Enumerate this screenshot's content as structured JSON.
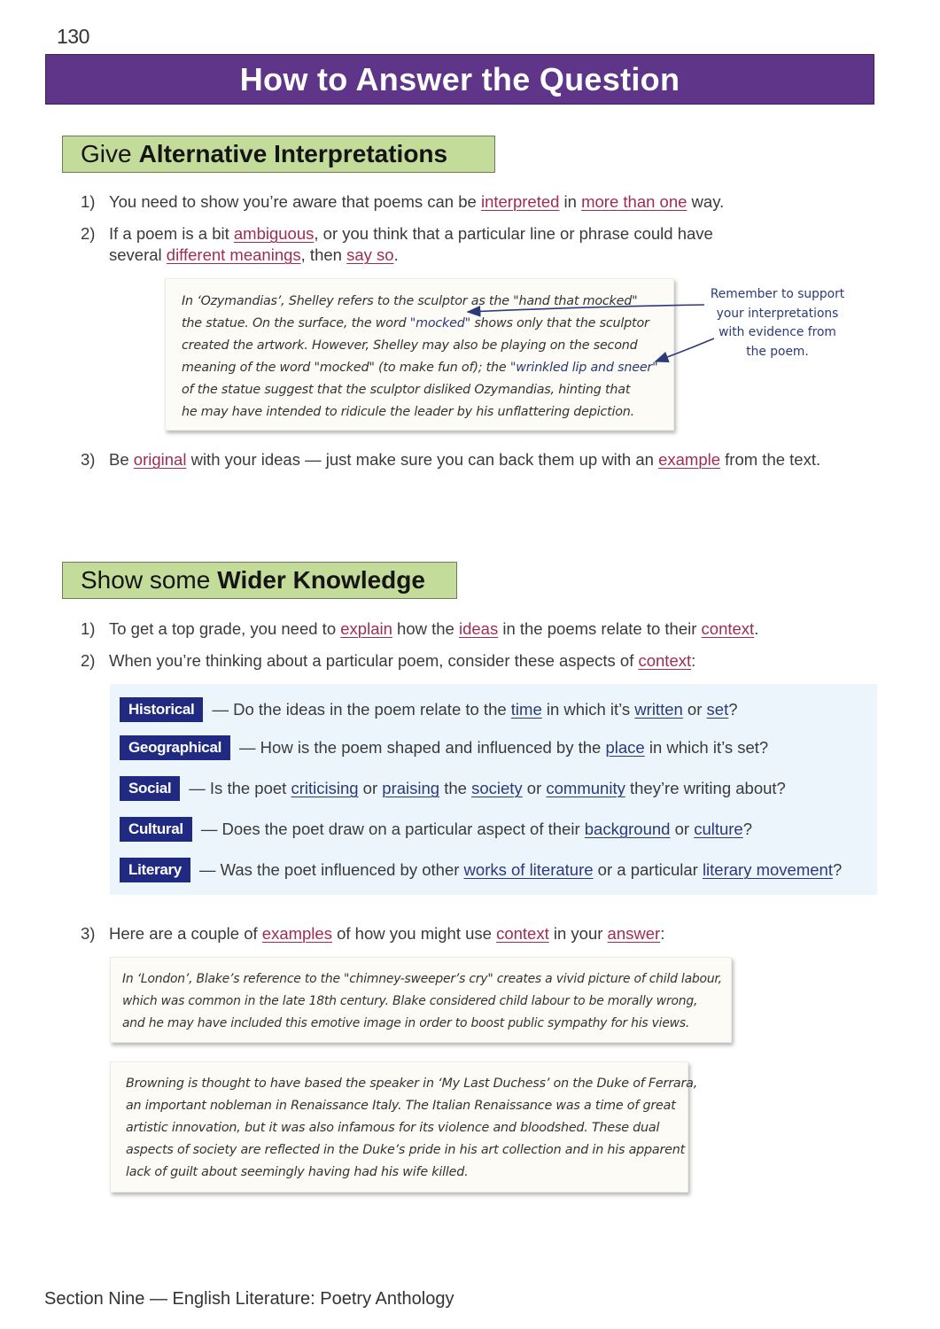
{
  "page_number": "130",
  "title": "How to Answer the Question",
  "section1": {
    "heading_plain": "Give",
    "heading_bold": "Alternative Interpretations",
    "items": [
      {
        "num": "1)",
        "parts": [
          {
            "t": "You need to show you’re aware that poems can be "
          },
          {
            "t": "interpreted",
            "kw": true
          },
          {
            "t": " in "
          },
          {
            "t": "more than one",
            "kw": true
          },
          {
            "t": " way."
          }
        ]
      },
      {
        "num": "2)",
        "line1": [
          {
            "t": "If a poem is a bit "
          },
          {
            "t": "ambiguous",
            "kw": true
          },
          {
            "t": ", or you think that a particular line or phrase could have"
          }
        ],
        "line2": [
          {
            "t": "several "
          },
          {
            "t": "different meanings",
            "kw": true
          },
          {
            "t": ", then "
          },
          {
            "t": "say so",
            "kw": true
          },
          {
            "t": "."
          }
        ]
      },
      {
        "num": "3)",
        "parts": [
          {
            "t": "Be "
          },
          {
            "t": "original",
            "kw": true
          },
          {
            "t": " with your ideas — just make sure you can back them up with an "
          },
          {
            "t": "example",
            "kw": true
          },
          {
            "t": " from the text."
          }
        ]
      }
    ],
    "example_box": {
      "lines": [
        [
          {
            "t": "In ‘Ozymandias’, Shelley refers to the sculptor as the \"hand that mocked\""
          }
        ],
        [
          {
            "t": "the statue.  On the surface, the word "
          },
          {
            "t": "\"mocked\"",
            "q": true
          },
          {
            "t": " shows only that the sculptor"
          }
        ],
        [
          {
            "t": "created the artwork.  However, Shelley may also be playing on the second"
          }
        ],
        [
          {
            "t": "meaning of the word \"mocked\" (to make fun of); the "
          },
          {
            "t": "\"wrinkled lip and sneer\"",
            "q": true
          }
        ],
        [
          {
            "t": "of the statue suggest that the sculptor disliked Ozymandias, hinting that"
          }
        ],
        [
          {
            "t": "he may have intended to ridicule the leader by his unflattering depiction."
          }
        ]
      ]
    },
    "annotation": [
      "Remember to support",
      "your interpretations",
      "with evidence from",
      "the poem."
    ]
  },
  "section2": {
    "heading_plain": "Show some",
    "heading_bold": "Wider Knowledge",
    "items": [
      {
        "num": "1)",
        "parts": [
          {
            "t": "To get a top grade, you need to "
          },
          {
            "t": "explain",
            "kw": true
          },
          {
            "t": " how the "
          },
          {
            "t": "ideas",
            "kw": true
          },
          {
            "t": " in the poems relate to their "
          },
          {
            "t": "context",
            "kw": true
          },
          {
            "t": "."
          }
        ]
      },
      {
        "num": "2)",
        "parts": [
          {
            "t": "When you’re thinking about a particular poem, consider these aspects of "
          },
          {
            "t": "context",
            "kw": true
          },
          {
            "t": ":"
          }
        ]
      },
      {
        "num": "3)",
        "parts": [
          {
            "t": "Here are a couple of "
          },
          {
            "t": "examples",
            "kw": true
          },
          {
            "t": " of how you might use "
          },
          {
            "t": "context",
            "kw": true
          },
          {
            "t": " in your "
          },
          {
            "t": "answer",
            "kw": true
          },
          {
            "t": ":"
          }
        ]
      }
    ],
    "context_aspects": [
      {
        "tag": "Historical",
        "parts": [
          {
            "t": "— Do the ideas in the poem relate to the "
          },
          {
            "t": "time",
            "kb": true
          },
          {
            "t": " in which it’s "
          },
          {
            "t": "written",
            "kb": true
          },
          {
            "t": " or "
          },
          {
            "t": "set",
            "kb": true
          },
          {
            "t": "?"
          }
        ]
      },
      {
        "tag": "Geographical",
        "parts": [
          {
            "t": "— How is the poem shaped and influenced by the "
          },
          {
            "t": "place",
            "kb": true
          },
          {
            "t": " in which it’s set?"
          }
        ]
      },
      {
        "tag": "Social",
        "parts": [
          {
            "t": "— Is the poet "
          },
          {
            "t": "criticising",
            "kb": true
          },
          {
            "t": " or "
          },
          {
            "t": "praising",
            "kb": true
          },
          {
            "t": " the "
          },
          {
            "t": "society",
            "kb": true
          },
          {
            "t": " or "
          },
          {
            "t": "community",
            "kb": true
          },
          {
            "t": " they’re writing about?"
          }
        ]
      },
      {
        "tag": "Cultural",
        "parts": [
          {
            "t": "— Does the poet draw on a particular aspect of their "
          },
          {
            "t": "background",
            "kb": true
          },
          {
            "t": " or "
          },
          {
            "t": "culture",
            "kb": true
          },
          {
            "t": "?"
          }
        ]
      },
      {
        "tag": "Literary",
        "parts": [
          {
            "t": "— Was the poet influenced by other "
          },
          {
            "t": "works of literature",
            "kb": true
          },
          {
            "t": " or a particular "
          },
          {
            "t": "literary movement",
            "kb": true
          },
          {
            "t": "?"
          }
        ]
      }
    ],
    "example_boxes": [
      {
        "lines": [
          "In ‘London’, Blake’s reference to the \"chimney-sweeper’s cry\" creates a vivid picture of child labour,",
          "which was common in the late 18th century.  Blake considered child labour to be morally wrong,",
          "and he may have included this emotive image in order to boost public sympathy for his views."
        ]
      },
      {
        "lines": [
          "Browning is thought to have based the speaker in ‘My Last Duchess’ on the Duke of Ferrara,",
          "an important nobleman in Renaissance Italy.  The Italian Renaissance was a time of great",
          "artistic innovation, but it was also infamous for its violence and bloodshed.  These dual",
          "aspects of society are reflected in the Duke’s pride in his art collection and in his apparent",
          "lack of guilt about seemingly having had his wife killed."
        ]
      }
    ]
  },
  "footer": "Section Nine — English Literature: Poetry Anthology",
  "colors": {
    "title_bar": "#5e3589",
    "section_heading_bg": "#c4dc99",
    "keyword": "#9c2d55",
    "context_keyword": "#2b3a78",
    "context_tag_bg": "#1f2a80",
    "context_panel_bg": "#ecf5fc",
    "example_box_bg": "#fcfbf6",
    "annotation": "#2b3a78"
  }
}
